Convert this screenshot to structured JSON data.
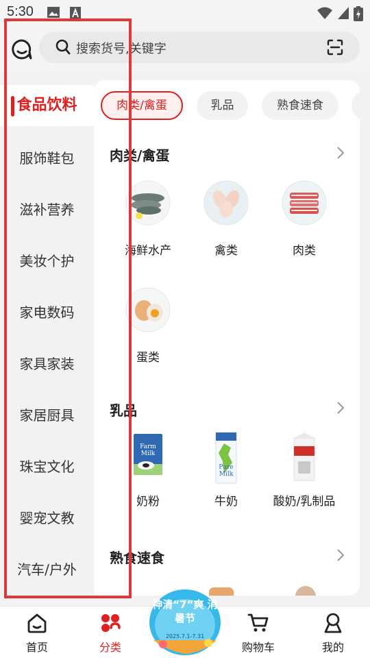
{
  "status_bar": {
    "time": "5:30"
  },
  "search": {
    "placeholder": "搜索货号,关键字"
  },
  "categories": {
    "active": "食品饮料",
    "items": [
      "服饰鞋包",
      "滋补营养",
      "美妆个护",
      "家电数码",
      "家具家装",
      "家居厨具",
      "珠宝文化",
      "婴宠文教",
      "汽车/户外"
    ]
  },
  "chips": [
    "肉类/禽蛋",
    "乳品",
    "熟食速食"
  ],
  "sections": [
    {
      "title": "肉类/禽蛋",
      "items": [
        "海鲜水产",
        "禽类",
        "肉类",
        "蛋类"
      ]
    },
    {
      "title": "乳品",
      "items": [
        "奶粉",
        "牛奶",
        "酸奶/乳制品"
      ]
    },
    {
      "title": "熟食速食"
    }
  ],
  "product_text": {
    "farm_milk": "Farm Milk",
    "pure_milk": "Pure Milk"
  },
  "promo": {
    "title": "神清“7”爽 消暑节",
    "dates": "2025.7.1-7.31"
  },
  "bottom_nav": [
    "首页",
    "分类",
    "购物车",
    "我的"
  ],
  "colors": {
    "accent": "#e02020",
    "highlight_box": "#e03838",
    "panel_bg": "#ffffff",
    "page_bg": "#f2f2f2"
  }
}
